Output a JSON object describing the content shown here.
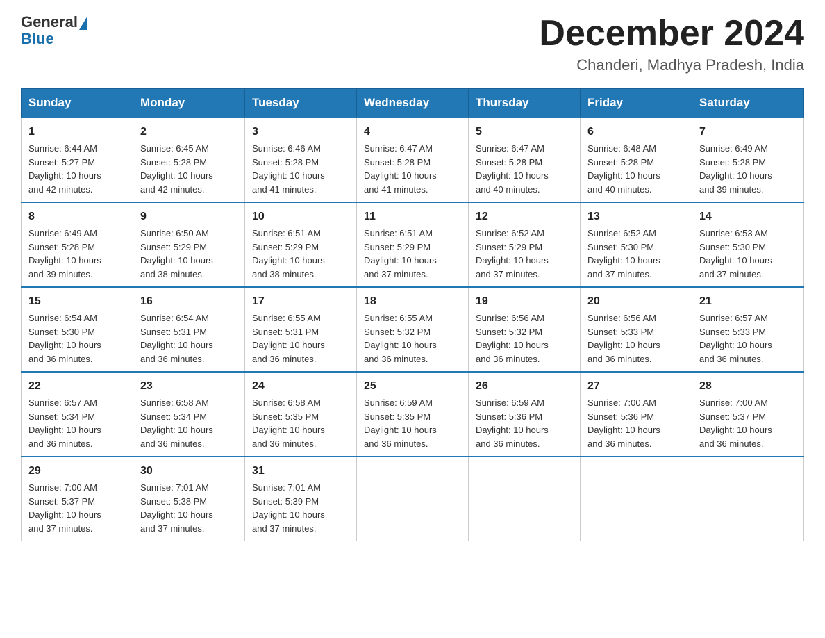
{
  "header": {
    "logo_general": "General",
    "logo_blue": "Blue",
    "title": "December 2024",
    "subtitle": "Chanderi, Madhya Pradesh, India"
  },
  "days_of_week": [
    "Sunday",
    "Monday",
    "Tuesday",
    "Wednesday",
    "Thursday",
    "Friday",
    "Saturday"
  ],
  "weeks": [
    [
      {
        "day": "1",
        "sunrise": "6:44 AM",
        "sunset": "5:27 PM",
        "daylight": "10 hours and 42 minutes."
      },
      {
        "day": "2",
        "sunrise": "6:45 AM",
        "sunset": "5:28 PM",
        "daylight": "10 hours and 42 minutes."
      },
      {
        "day": "3",
        "sunrise": "6:46 AM",
        "sunset": "5:28 PM",
        "daylight": "10 hours and 41 minutes."
      },
      {
        "day": "4",
        "sunrise": "6:47 AM",
        "sunset": "5:28 PM",
        "daylight": "10 hours and 41 minutes."
      },
      {
        "day": "5",
        "sunrise": "6:47 AM",
        "sunset": "5:28 PM",
        "daylight": "10 hours and 40 minutes."
      },
      {
        "day": "6",
        "sunrise": "6:48 AM",
        "sunset": "5:28 PM",
        "daylight": "10 hours and 40 minutes."
      },
      {
        "day": "7",
        "sunrise": "6:49 AM",
        "sunset": "5:28 PM",
        "daylight": "10 hours and 39 minutes."
      }
    ],
    [
      {
        "day": "8",
        "sunrise": "6:49 AM",
        "sunset": "5:28 PM",
        "daylight": "10 hours and 39 minutes."
      },
      {
        "day": "9",
        "sunrise": "6:50 AM",
        "sunset": "5:29 PM",
        "daylight": "10 hours and 38 minutes."
      },
      {
        "day": "10",
        "sunrise": "6:51 AM",
        "sunset": "5:29 PM",
        "daylight": "10 hours and 38 minutes."
      },
      {
        "day": "11",
        "sunrise": "6:51 AM",
        "sunset": "5:29 PM",
        "daylight": "10 hours and 37 minutes."
      },
      {
        "day": "12",
        "sunrise": "6:52 AM",
        "sunset": "5:29 PM",
        "daylight": "10 hours and 37 minutes."
      },
      {
        "day": "13",
        "sunrise": "6:52 AM",
        "sunset": "5:30 PM",
        "daylight": "10 hours and 37 minutes."
      },
      {
        "day": "14",
        "sunrise": "6:53 AM",
        "sunset": "5:30 PM",
        "daylight": "10 hours and 37 minutes."
      }
    ],
    [
      {
        "day": "15",
        "sunrise": "6:54 AM",
        "sunset": "5:30 PM",
        "daylight": "10 hours and 36 minutes."
      },
      {
        "day": "16",
        "sunrise": "6:54 AM",
        "sunset": "5:31 PM",
        "daylight": "10 hours and 36 minutes."
      },
      {
        "day": "17",
        "sunrise": "6:55 AM",
        "sunset": "5:31 PM",
        "daylight": "10 hours and 36 minutes."
      },
      {
        "day": "18",
        "sunrise": "6:55 AM",
        "sunset": "5:32 PM",
        "daylight": "10 hours and 36 minutes."
      },
      {
        "day": "19",
        "sunrise": "6:56 AM",
        "sunset": "5:32 PM",
        "daylight": "10 hours and 36 minutes."
      },
      {
        "day": "20",
        "sunrise": "6:56 AM",
        "sunset": "5:33 PM",
        "daylight": "10 hours and 36 minutes."
      },
      {
        "day": "21",
        "sunrise": "6:57 AM",
        "sunset": "5:33 PM",
        "daylight": "10 hours and 36 minutes."
      }
    ],
    [
      {
        "day": "22",
        "sunrise": "6:57 AM",
        "sunset": "5:34 PM",
        "daylight": "10 hours and 36 minutes."
      },
      {
        "day": "23",
        "sunrise": "6:58 AM",
        "sunset": "5:34 PM",
        "daylight": "10 hours and 36 minutes."
      },
      {
        "day": "24",
        "sunrise": "6:58 AM",
        "sunset": "5:35 PM",
        "daylight": "10 hours and 36 minutes."
      },
      {
        "day": "25",
        "sunrise": "6:59 AM",
        "sunset": "5:35 PM",
        "daylight": "10 hours and 36 minutes."
      },
      {
        "day": "26",
        "sunrise": "6:59 AM",
        "sunset": "5:36 PM",
        "daylight": "10 hours and 36 minutes."
      },
      {
        "day": "27",
        "sunrise": "7:00 AM",
        "sunset": "5:36 PM",
        "daylight": "10 hours and 36 minutes."
      },
      {
        "day": "28",
        "sunrise": "7:00 AM",
        "sunset": "5:37 PM",
        "daylight": "10 hours and 36 minutes."
      }
    ],
    [
      {
        "day": "29",
        "sunrise": "7:00 AM",
        "sunset": "5:37 PM",
        "daylight": "10 hours and 37 minutes."
      },
      {
        "day": "30",
        "sunrise": "7:01 AM",
        "sunset": "5:38 PM",
        "daylight": "10 hours and 37 minutes."
      },
      {
        "day": "31",
        "sunrise": "7:01 AM",
        "sunset": "5:39 PM",
        "daylight": "10 hours and 37 minutes."
      },
      null,
      null,
      null,
      null
    ]
  ],
  "labels": {
    "sunrise": "Sunrise:",
    "sunset": "Sunset:",
    "daylight": "Daylight:"
  }
}
